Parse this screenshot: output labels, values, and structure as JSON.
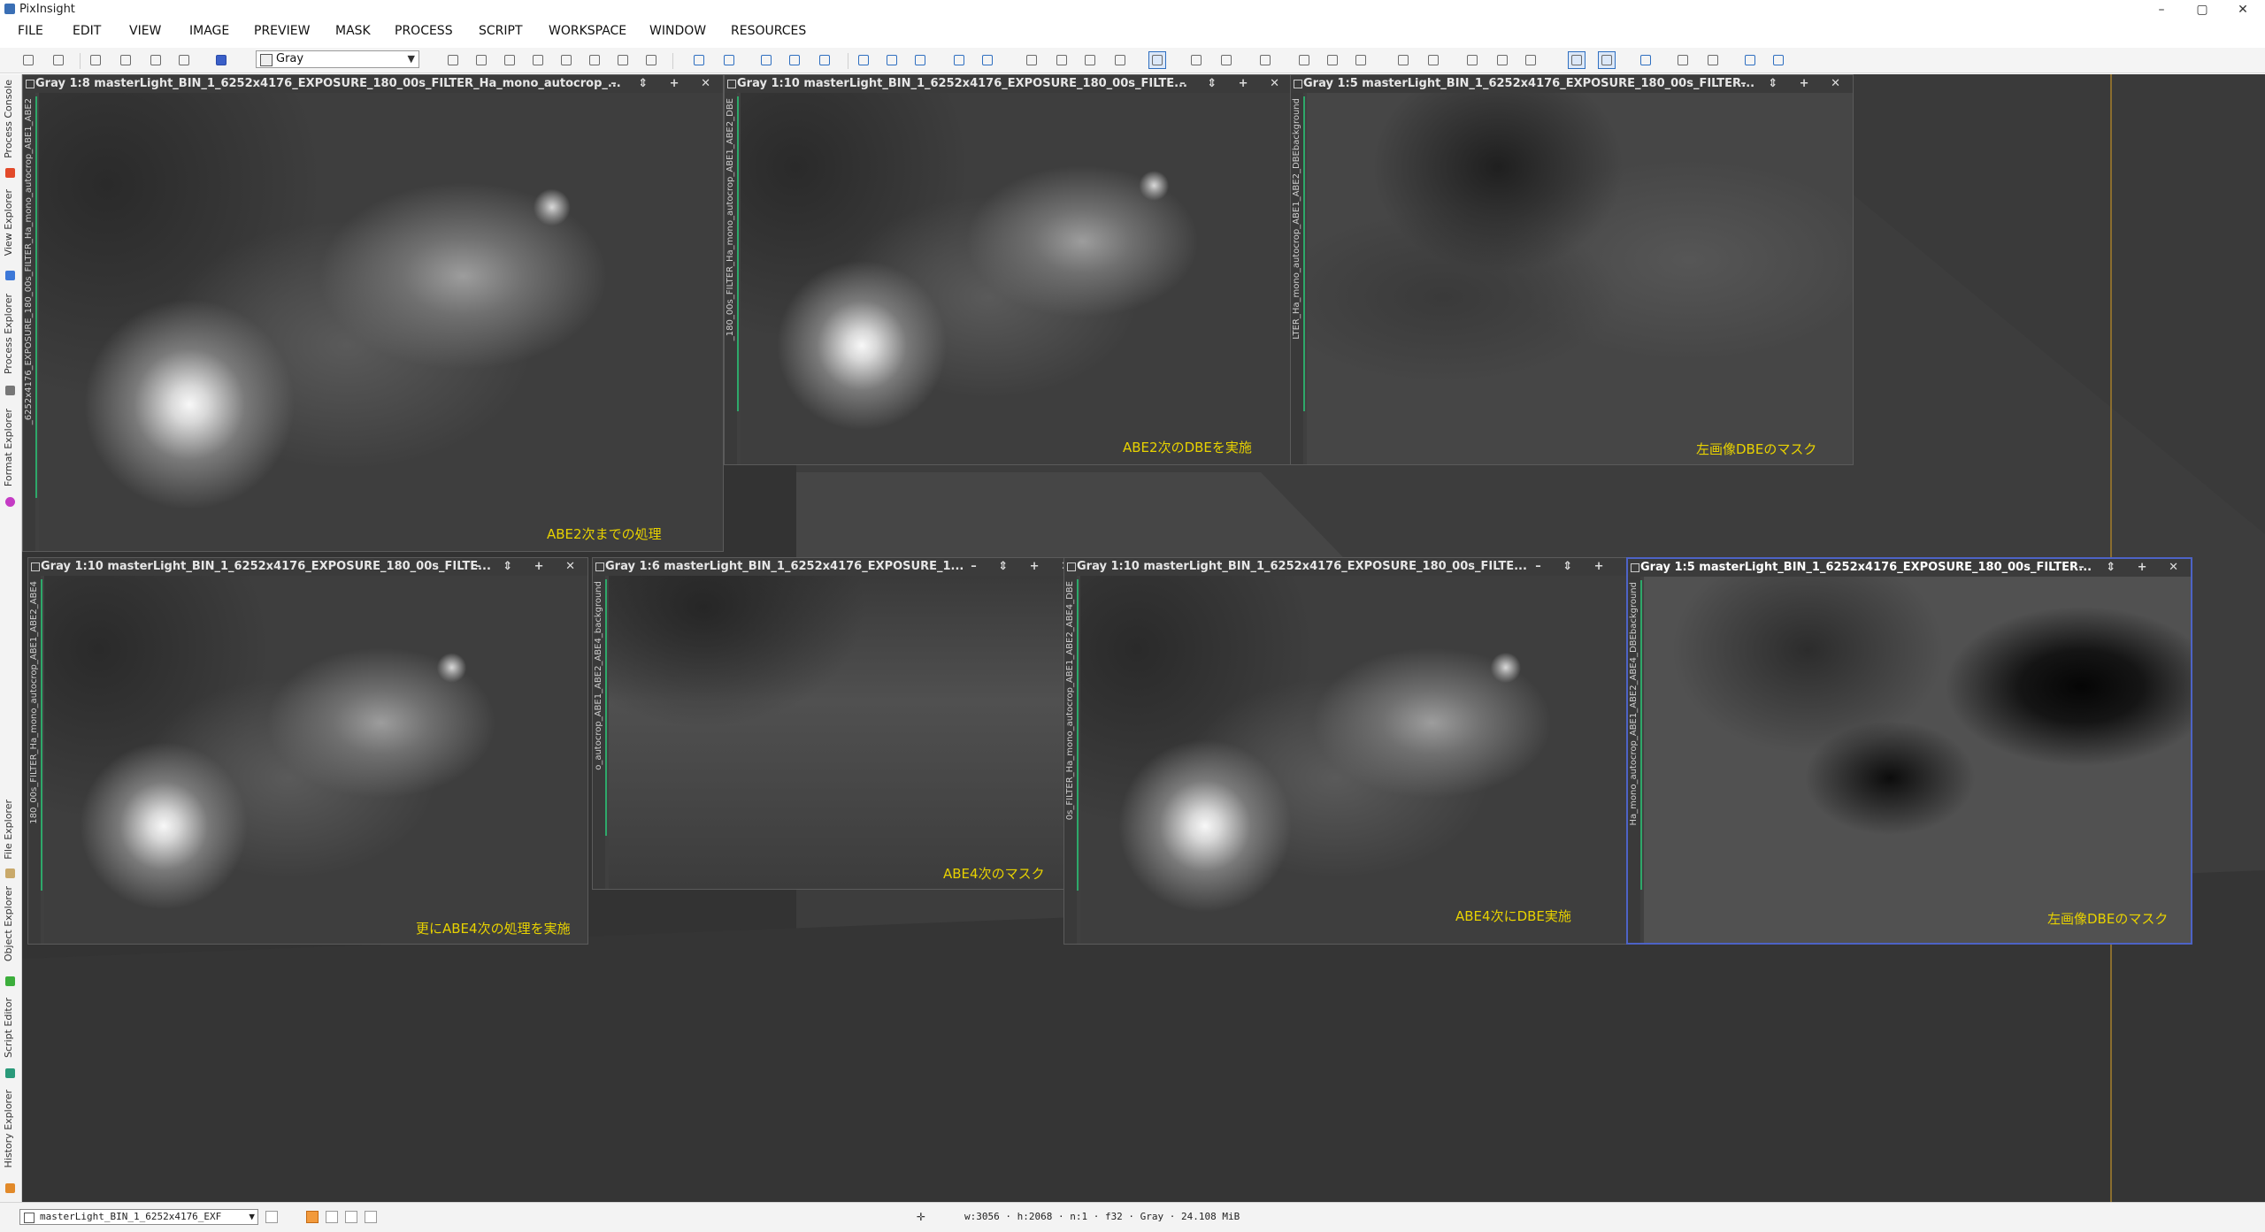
{
  "app": {
    "title": "PixInsight"
  },
  "window_controls": {
    "minimize": "–",
    "maximize": "▢",
    "close": "✕"
  },
  "menu": [
    "FILE",
    "EDIT",
    "VIEW",
    "IMAGE",
    "PREVIEW",
    "MASK",
    "PROCESS",
    "SCRIPT",
    "WORKSPACE",
    "WINDOW",
    "RESOURCES"
  ],
  "toolbar": {
    "color_space_select": "Gray"
  },
  "dock_tabs": {
    "process_console": "Process Console",
    "view_explorer": "View Explorer",
    "process_explorer": "Process Explorer",
    "format_explorer": "Format Explorer",
    "file_explorer": "File Explorer",
    "object_explorer": "Object Explorer",
    "script_editor": "Script Editor",
    "history_explorer": "History Explorer"
  },
  "image_windows": [
    {
      "title": "Gray 1:8 masterLight_BIN_1_6252x4176_EXPOSURE_180_00s_FILTER_Ha_mono_autocrop_...",
      "side_id": "_6252x4176_EXPOSURE_180_00s_FILTER_Ha_mono_autocrop_ABE1_ABE2",
      "caption": "ABE2次までの処理"
    },
    {
      "title": "Gray 1:10 masterLight_BIN_1_6252x4176_EXPOSURE_180_00s_FILTE...",
      "side_id": "_180_00s_FILTER_Ha_mono_autocrop_ABE1_ABE2_DBE",
      "caption": "ABE2次のDBEを実施"
    },
    {
      "title": "Gray 1:5 masterLight_BIN_1_6252x4176_EXPOSURE_180_00s_FILTER...",
      "side_id": "LTER_Ha_mono_autocrop_ABE1_ABE2_DBEbackground",
      "caption": "左画像DBEのマスク"
    },
    {
      "title": "Gray 1:10 masterLight_BIN_1_6252x4176_EXPOSURE_180_00s_FILTE...",
      "side_id": "180_00s_FILTER_Ha_mono_autocrop_ABE1_ABE2_ABE4",
      "caption": "更にABE4次の処理を実施"
    },
    {
      "title": "Gray 1:6 masterLight_BIN_1_6252x4176_EXPOSURE_1...",
      "side_id": "o_autocrop_ABE1_ABE2_ABE4_background",
      "caption": "ABE4次のマスク"
    },
    {
      "title": "Gray 1:10 masterLight_BIN_1_6252x4176_EXPOSURE_180_00s_FILTE...",
      "side_id": "0s_FILTER_Ha_mono_autocrop_ABE1_ABE2_ABE4_DBE",
      "caption": "ABE4次にDBE実施"
    },
    {
      "title": "Gray 1:5 masterLight_BIN_1_6252x4176_EXPOSURE_180_00s_FILTER...",
      "side_id": "Ha_mono_autocrop_ABE1_ABE2_ABE4_DBEbackground",
      "caption": "左画像DBEのマスク"
    }
  ],
  "window_buttons": "– ⇕ + ✕",
  "statusbar": {
    "view_select": "masterLight_BIN_1_6252x4176_EXF",
    "info": "w:3056 · h:2068 · n:1 · f32 · Gray · 24.108 MiB"
  }
}
